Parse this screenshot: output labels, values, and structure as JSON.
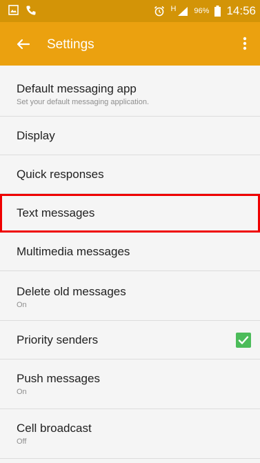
{
  "status_bar": {
    "time": "14:56",
    "battery_percent": "96%",
    "network_type": "H",
    "icons": [
      "gallery-icon",
      "phone-icon",
      "alarm-icon",
      "signal-icon",
      "battery-icon"
    ]
  },
  "action_bar": {
    "title": "Settings",
    "back_icon": "arrow-left-icon",
    "menu_icon": "more-vert-icon"
  },
  "colors": {
    "status_bar": "#d39407",
    "action_bar": "#eba10f",
    "highlight": "#ef0000",
    "checkbox": "#4cbc5a"
  },
  "settings": [
    {
      "title": "Default messaging app",
      "subtitle": "Set your default messaging application."
    },
    {
      "title": "Display"
    },
    {
      "title": "Quick responses"
    },
    {
      "title": "Text messages"
    },
    {
      "title": "Multimedia messages"
    },
    {
      "title": "Delete old messages",
      "subtitle": "On"
    },
    {
      "title": "Priority senders",
      "checked": true
    },
    {
      "title": "Push messages",
      "subtitle": "On"
    },
    {
      "title": "Cell broadcast",
      "subtitle": "Off"
    }
  ]
}
